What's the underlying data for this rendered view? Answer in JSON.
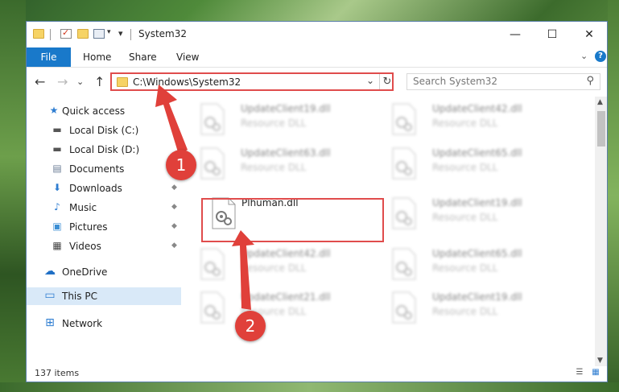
{
  "window": {
    "title": "System32",
    "controls": {
      "minimize": "—",
      "maximize": "☐",
      "close": "✕"
    }
  },
  "ribbon": {
    "file": "File",
    "tabs": [
      "Home",
      "Share",
      "View"
    ],
    "collapse_glyph": "⌄",
    "help_glyph": "?"
  },
  "nav": {
    "back": "←",
    "forward": "→",
    "recent": "⌄",
    "up": "↑",
    "address": "C:\\Windows\\System32",
    "address_dropdown": "⌄",
    "refresh": "↻",
    "search_placeholder": "Search System32",
    "search_glyph": "⚲"
  },
  "sidebar": {
    "items": [
      {
        "label": "Quick access",
        "icon": "star-icon",
        "glyph": "★",
        "color": "#2e7dd1",
        "pinned": false
      },
      {
        "label": "Local Disk (C:)",
        "icon": "drive-icon",
        "glyph": "▬",
        "color": "#555555",
        "pinned": false
      },
      {
        "label": "Local Disk (D:)",
        "icon": "drive-icon",
        "glyph": "▬",
        "color": "#555555",
        "pinned": false
      },
      {
        "label": "Documents",
        "icon": "document-icon",
        "glyph": "▤",
        "color": "#6b7d96",
        "pinned": false
      },
      {
        "label": "Downloads",
        "icon": "download-icon",
        "glyph": "⬇",
        "color": "#2e7dd1",
        "pinned": true
      },
      {
        "label": "Music",
        "icon": "music-icon",
        "glyph": "♪",
        "color": "#2e7dd1",
        "pinned": true
      },
      {
        "label": "Pictures",
        "icon": "pictures-icon",
        "glyph": "▣",
        "color": "#3c8fd4",
        "pinned": true
      },
      {
        "label": "Videos",
        "icon": "videos-icon",
        "glyph": "▦",
        "color": "#444444",
        "pinned": true
      },
      {
        "label": "OneDrive",
        "icon": "cloud-icon",
        "glyph": "☁",
        "color": "#1f6fc5",
        "pinned": false
      },
      {
        "label": "This PC",
        "icon": "computer-icon",
        "glyph": "▭",
        "color": "#2e7dd1",
        "pinned": false,
        "selected": true
      },
      {
        "label": "Network",
        "icon": "network-icon",
        "glyph": "⊞",
        "color": "#2e7dd1",
        "pinned": false
      }
    ],
    "pin_glyph": "📌"
  },
  "files": [
    {
      "name": "UpdateClient19.dll",
      "desc": "Resource DLL",
      "blurred": true
    },
    {
      "name": "UpdateClient42.dll",
      "desc": "Resource DLL",
      "blurred": true
    },
    {
      "name": "UpdateClient63.dll",
      "desc": "Resource DLL",
      "blurred": true
    },
    {
      "name": "UpdateClient65.dll",
      "desc": "Resource DLL",
      "blurred": true
    },
    {
      "name": "Plhuman.dll",
      "desc": "",
      "blurred": false,
      "highlighted": true
    },
    {
      "name": "UpdateClient19.dll",
      "desc": "Resource DLL",
      "blurred": true
    },
    {
      "name": "UpdateClient42.dll",
      "desc": "Resource DLL",
      "blurred": true
    },
    {
      "name": "UpdateClient65.dll",
      "desc": "Resource DLL",
      "blurred": true
    },
    {
      "name": "UpdateClient21.dll",
      "desc": "Resource DLL",
      "blurred": true
    },
    {
      "name": "UpdateClient19.dll",
      "desc": "Resource DLL",
      "blurred": true
    }
  ],
  "status": {
    "item_count": "137 items",
    "view_details_glyph": "☰",
    "view_tiles_glyph": "▦"
  },
  "annotations": {
    "callout_1": "1",
    "callout_2": "2",
    "color": "#e0403a"
  }
}
